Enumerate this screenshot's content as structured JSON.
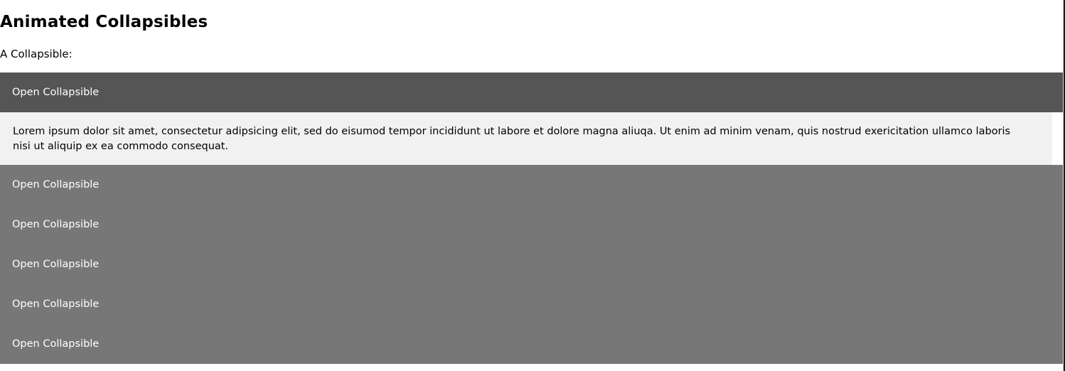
{
  "page": {
    "title": "Animated Collapsibles",
    "intro": "A Collapsible:"
  },
  "accordion": {
    "items": [
      {
        "label": "Open Collapsible",
        "expanded": true,
        "content": "Lorem ipsum dolor sit amet, consectetur adipsicing elit, sed do eisumod tempor incididunt ut labore et dolore magna aliuqa. Ut enim ad minim venam, quis nostrud exericitation ullamco laboris nisi ut aliquip ex ea commodo consequat."
      },
      {
        "label": "Open Collapsible",
        "expanded": false
      },
      {
        "label": "Open Collapsible",
        "expanded": false
      },
      {
        "label": "Open Collapsible",
        "expanded": false
      },
      {
        "label": "Open Collapsible",
        "expanded": false
      },
      {
        "label": "Open Collapsible",
        "expanded": false
      }
    ]
  },
  "colors": {
    "collapsible_active": "#555555",
    "collapsible": "#777777",
    "content_bg": "#f1f1f1",
    "text_light": "#ffffff"
  }
}
